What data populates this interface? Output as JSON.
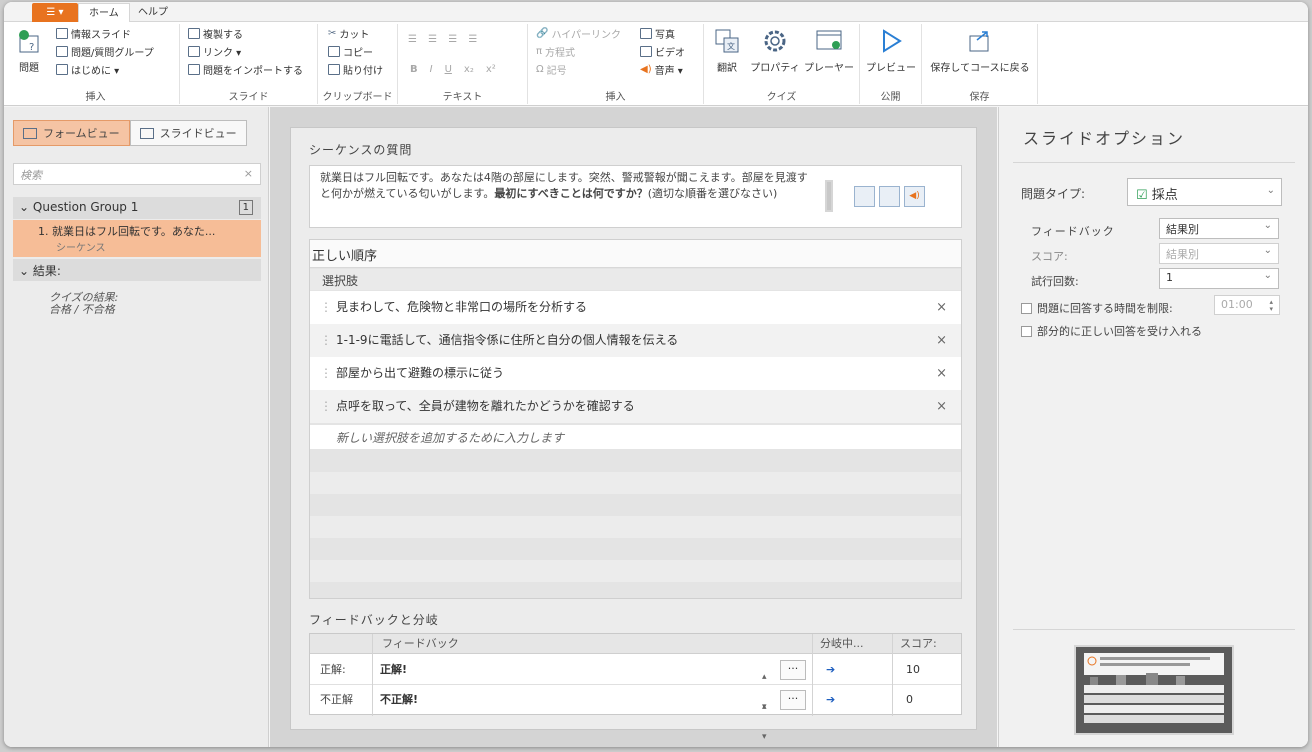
{
  "tabs": {
    "app_button": "☰ ▾",
    "home": "ホーム",
    "help": "ヘルプ"
  },
  "ribbon": {
    "insert": {
      "question": "問題",
      "info_slide": "情報スライド",
      "question_group": "問題/質問グループ",
      "intro": "はじめに ▾",
      "label": "挿入"
    },
    "slide": {
      "duplicate": "複製する",
      "link": "リンク ▾",
      "import": "問題をインポートする",
      "label": "スライド"
    },
    "clipboard": {
      "cut": "カット",
      "copy": "コピー",
      "paste": "貼り付け",
      "label": "クリップボード"
    },
    "text": {
      "bold": "B",
      "italic": "I",
      "underline": "U",
      "sub": "x₂",
      "sup": "x²",
      "label": "テキスト"
    },
    "insert2": {
      "hyperlink": "ハイパーリンク",
      "equation": "方程式",
      "symbol": "記号",
      "photo": "写真",
      "video": "ビデオ",
      "audio": "音声 ▾",
      "label": "挿入"
    },
    "quiz": {
      "translate": "翻訳",
      "properties": "プロパティ",
      "player": "プレーヤー",
      "label": "クイズ"
    },
    "publish": {
      "preview": "プレビュー",
      "label": "公開"
    },
    "save": {
      "save_return": "保存してコースに戻る",
      "label": "保存"
    }
  },
  "left": {
    "form_view": "フォームビュー",
    "slide_view": "スライドビュー",
    "search_placeholder": "検索",
    "search_clear": "×",
    "group": "Question Group 1",
    "group_count": "1",
    "item_title": "1. 就業日はフル回転です。あなた...",
    "item_type": "シーケンス",
    "results": "結果:",
    "quiz_result": "クイズの結果:",
    "pass_fail": "合格 / 不合格"
  },
  "center": {
    "seq_title": "シーケンスの質問",
    "q_text_1": "就業日はフル回転です。あなたは4階の部屋にします。突然、警戒警報が聞こえます。部屋を見渡すと何かが燃えている匂いがします。",
    "q_text_bold": "最初にすべきことは何ですか？",
    "q_text_2": "(適切な順番を選びなさい)",
    "correct_order": "正しい順序",
    "choices_header": "選択肢",
    "choices": [
      "見まわして、危険物と非常口の場所を分析する",
      "1-1-9に電話して、通信指令係に住所と自分の個人情報を伝える",
      "部屋から出て避難の標示に従う",
      "点呼を取って、全員が建物を離れたかどうかを確認する"
    ],
    "remove": "×",
    "new_choice": "新しい選択肢を追加するために入力します",
    "fb_title": "フィードバックと分岐",
    "fb_headers": {
      "feedback": "フィードバック",
      "branch": "分岐中...",
      "score": "スコア:"
    },
    "fb_rows": [
      {
        "label": "正解:",
        "text": "正解!",
        "branch": "➔",
        "score": "10"
      },
      {
        "label": "不正解",
        "text": "不正解!",
        "branch": "➔",
        "score": "0"
      }
    ],
    "more": "···"
  },
  "right": {
    "title": "スライドオプション",
    "qtype_label": "問題タイプ:",
    "qtype_value": "採点",
    "feedback_label": "フィードバック",
    "feedback_value": "結果別",
    "score_label": "スコア:",
    "score_value": "結果別",
    "attempts_label": "試行回数:",
    "attempts_value": "1",
    "time_limit": "問題に回答する時間を制限:",
    "time_value": "01:00",
    "partial": "部分的に正しい回答を受け入れる"
  }
}
